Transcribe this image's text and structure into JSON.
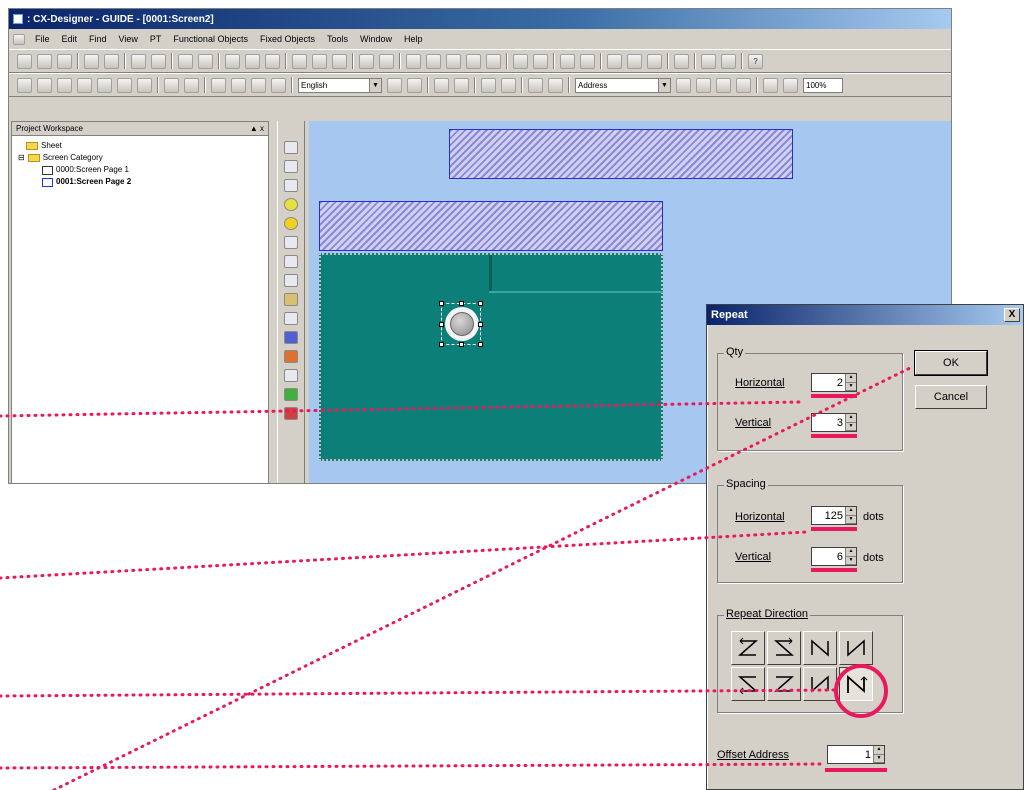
{
  "window": {
    "title": ": CX-Designer - GUIDE - [0001:Screen2]"
  },
  "menu": [
    "File",
    "Edit",
    "Find",
    "View",
    "PT",
    "Functional Objects",
    "Fixed Objects",
    "Tools",
    "Window",
    "Help"
  ],
  "toolbar": {
    "language": "English",
    "address": "Address",
    "zoom": "100%"
  },
  "workspace": {
    "title": "Project Workspace",
    "pin": "▲ x",
    "items": [
      {
        "label": "Sheet"
      },
      {
        "label": "Screen Category"
      },
      {
        "label": "0000:Screen Page 1"
      },
      {
        "label": "0001:Screen Page 2"
      }
    ]
  },
  "dialog": {
    "title": "Repeat",
    "close": "X",
    "qty": {
      "label": "Qty",
      "horizontal_label": "Horizontal",
      "horizontal": "2",
      "vertical_label": "Vertical",
      "vertical": "3"
    },
    "spacing": {
      "label": "Spacing",
      "horizontal_label": "Horizontal",
      "horizontal": "125",
      "vertical_label": "Vertical",
      "vertical": "6",
      "unit": "dots"
    },
    "repeat_direction": {
      "label": "Repeat Direction",
      "selected": "right-column-bottom"
    },
    "offset": {
      "label": "Offset Address",
      "value": "1"
    },
    "ok": "OK",
    "cancel": "Cancel"
  },
  "colors": {
    "accent": "#e8195f",
    "canvas": "#a6c8f0",
    "panel": "#0c8078"
  }
}
